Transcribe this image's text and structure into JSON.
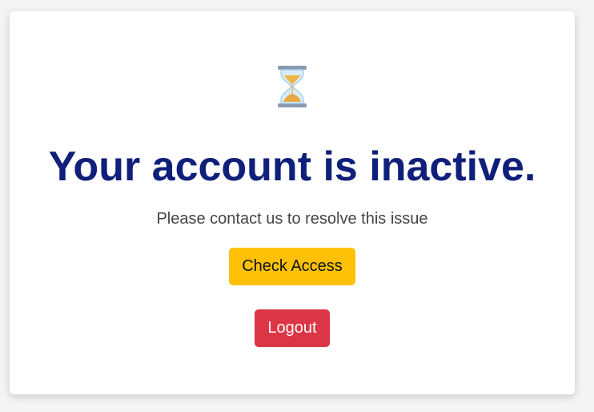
{
  "icon": {
    "name": "hourglass-icon"
  },
  "title": "Your account is inactive.",
  "message": "Please contact us to resolve this issue",
  "buttons": {
    "check_access": "Check Access",
    "logout": "Logout"
  },
  "colors": {
    "title": "#0f1f7a",
    "check_access": "#ffc107",
    "logout": "#dc3545"
  }
}
